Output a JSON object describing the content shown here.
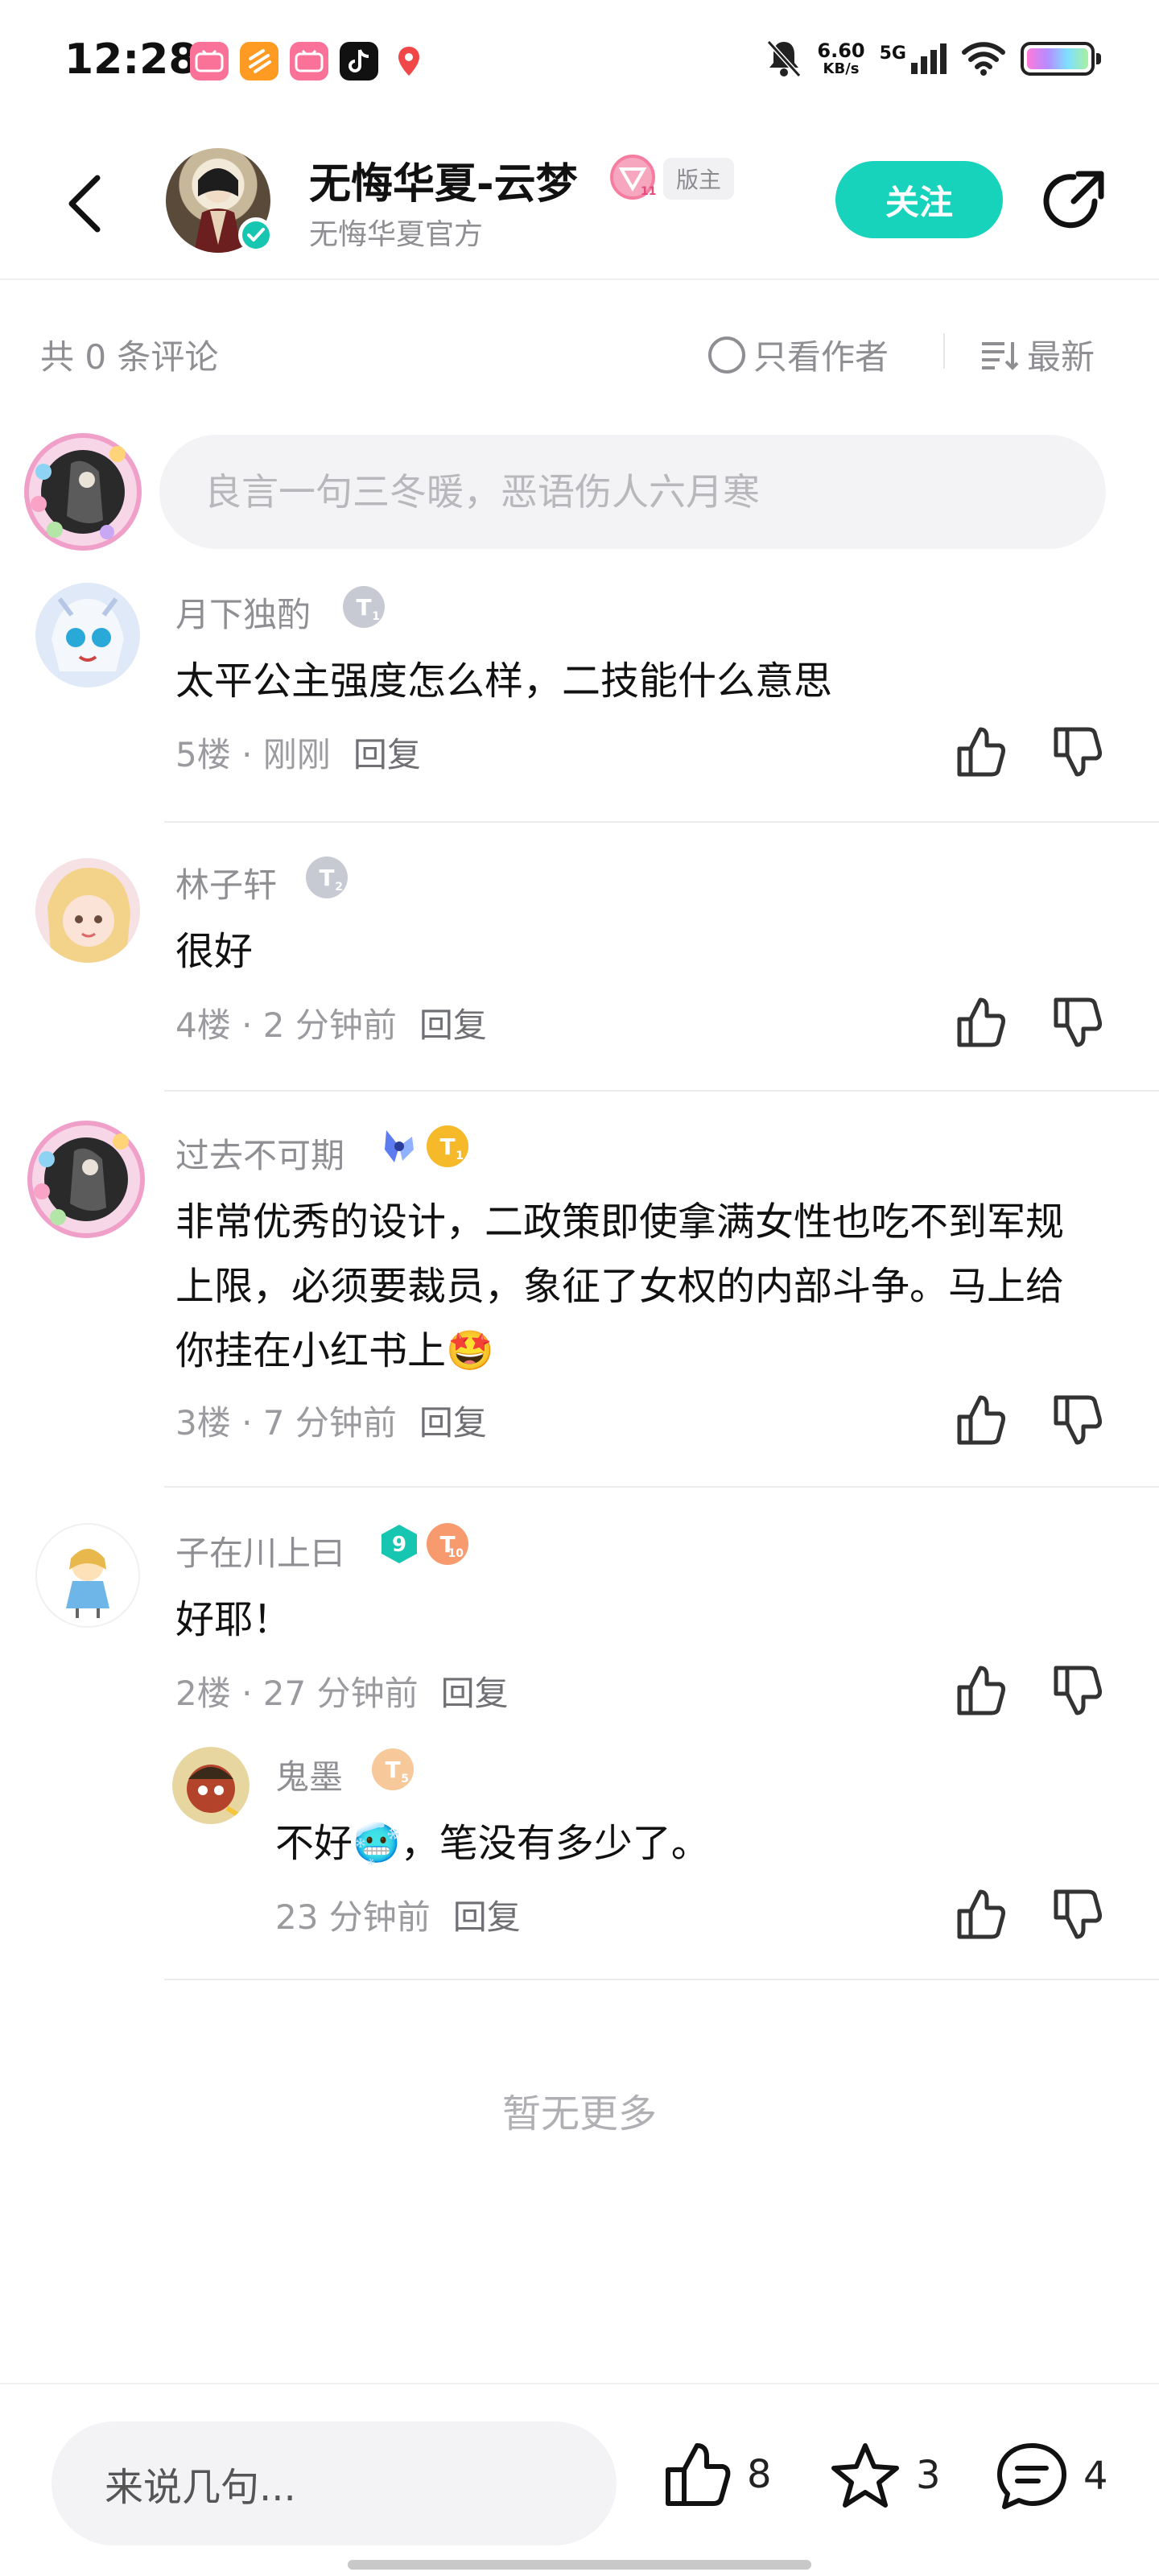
{
  "status_bar": {
    "time": "12:28",
    "apps": [
      "bilibili",
      "bili-orange",
      "bilibili",
      "tiktok",
      "map-pin"
    ],
    "net_speed_value": "6.60",
    "net_speed_unit": "KB/s",
    "network": "5G"
  },
  "header": {
    "author_name": "无悔华夏-云梦",
    "author_level": "11",
    "mod_tag": "版主",
    "author_subtitle": "无悔华夏官方",
    "follow_label": "关注"
  },
  "comments_header": {
    "count_text": "共 0 条评论",
    "only_author_label": "只看作者",
    "sort_label": "最新"
  },
  "composer": {
    "placeholder": "良言一句三冬暖，恶语伤人六月寒"
  },
  "comments": [
    {
      "user": "月下独酌",
      "level": "1",
      "text": "太平公主强度怎么样，二技能什么意思",
      "floor": "5楼",
      "time": "刚刚",
      "reply_label": "回复"
    },
    {
      "user": "林子轩",
      "level": "2",
      "text": "很好",
      "floor": "4楼",
      "time": "2 分钟前",
      "reply_label": "回复"
    },
    {
      "user": "过去不可期",
      "level": "1",
      "text": "非常优秀的设计，二政策即使拿满女性也吃不到军规上限，必须要裁员，象征了女权的内部斗争。马上给你挂在小红书上🤩",
      "floor": "3楼",
      "time": "7 分钟前",
      "reply_label": "回复"
    },
    {
      "user": "子在川上曰",
      "level": "10",
      "badge_num": "9",
      "text": "好耶！",
      "floor": "2楼",
      "time": "27 分钟前",
      "reply_label": "回复"
    }
  ],
  "sub_reply": {
    "user": "鬼墨",
    "level": "5",
    "text": "不好🥶，笔没有多少了。",
    "time": "23 分钟前",
    "reply_label": "回复"
  },
  "no_more": "暂无更多",
  "bottom_bar": {
    "input_placeholder": "来说几句...",
    "like_count": "8",
    "favorite_count": "3",
    "comment_count": "4"
  },
  "colors": {
    "accent": "#17d3bb",
    "muted": "#8e8e93"
  }
}
